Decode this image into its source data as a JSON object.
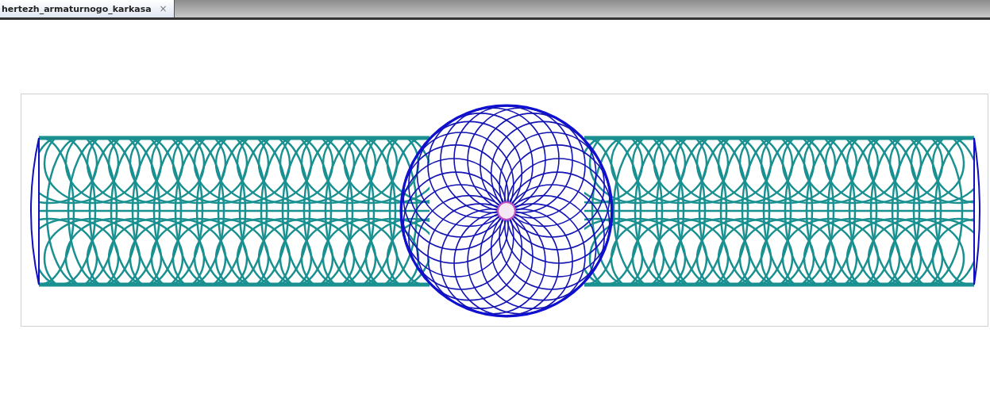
{
  "tabs": [
    {
      "label": "hertezh_armaturnogo_karkasa",
      "close": "×",
      "selected": true
    }
  ]
}
